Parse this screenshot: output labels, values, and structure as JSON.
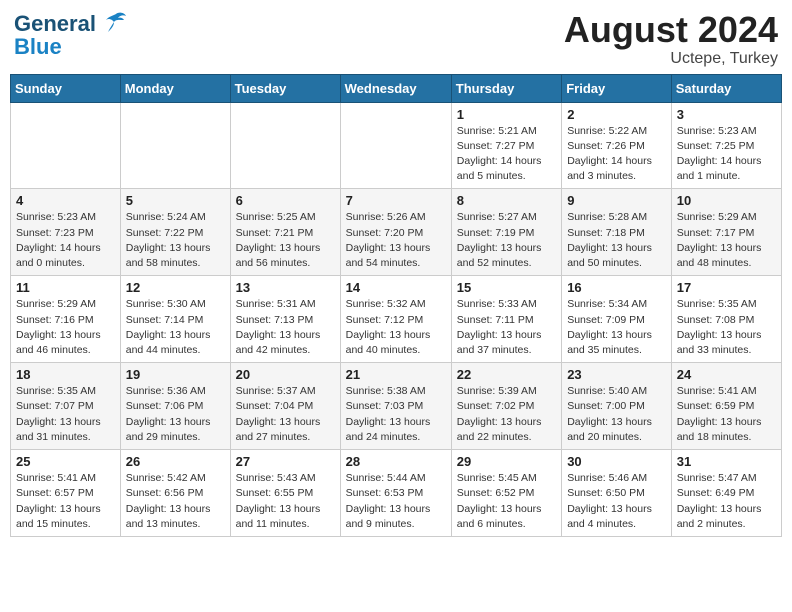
{
  "header": {
    "logo_line1": "General",
    "logo_line2": "Blue",
    "month_year": "August 2024",
    "location": "Uctepe, Turkey"
  },
  "weekdays": [
    "Sunday",
    "Monday",
    "Tuesday",
    "Wednesday",
    "Thursday",
    "Friday",
    "Saturday"
  ],
  "weeks": [
    [
      {
        "day": "",
        "info": ""
      },
      {
        "day": "",
        "info": ""
      },
      {
        "day": "",
        "info": ""
      },
      {
        "day": "",
        "info": ""
      },
      {
        "day": "1",
        "info": "Sunrise: 5:21 AM\nSunset: 7:27 PM\nDaylight: 14 hours\nand 5 minutes."
      },
      {
        "day": "2",
        "info": "Sunrise: 5:22 AM\nSunset: 7:26 PM\nDaylight: 14 hours\nand 3 minutes."
      },
      {
        "day": "3",
        "info": "Sunrise: 5:23 AM\nSunset: 7:25 PM\nDaylight: 14 hours\nand 1 minute."
      }
    ],
    [
      {
        "day": "4",
        "info": "Sunrise: 5:23 AM\nSunset: 7:23 PM\nDaylight: 14 hours\nand 0 minutes."
      },
      {
        "day": "5",
        "info": "Sunrise: 5:24 AM\nSunset: 7:22 PM\nDaylight: 13 hours\nand 58 minutes."
      },
      {
        "day": "6",
        "info": "Sunrise: 5:25 AM\nSunset: 7:21 PM\nDaylight: 13 hours\nand 56 minutes."
      },
      {
        "day": "7",
        "info": "Sunrise: 5:26 AM\nSunset: 7:20 PM\nDaylight: 13 hours\nand 54 minutes."
      },
      {
        "day": "8",
        "info": "Sunrise: 5:27 AM\nSunset: 7:19 PM\nDaylight: 13 hours\nand 52 minutes."
      },
      {
        "day": "9",
        "info": "Sunrise: 5:28 AM\nSunset: 7:18 PM\nDaylight: 13 hours\nand 50 minutes."
      },
      {
        "day": "10",
        "info": "Sunrise: 5:29 AM\nSunset: 7:17 PM\nDaylight: 13 hours\nand 48 minutes."
      }
    ],
    [
      {
        "day": "11",
        "info": "Sunrise: 5:29 AM\nSunset: 7:16 PM\nDaylight: 13 hours\nand 46 minutes."
      },
      {
        "day": "12",
        "info": "Sunrise: 5:30 AM\nSunset: 7:14 PM\nDaylight: 13 hours\nand 44 minutes."
      },
      {
        "day": "13",
        "info": "Sunrise: 5:31 AM\nSunset: 7:13 PM\nDaylight: 13 hours\nand 42 minutes."
      },
      {
        "day": "14",
        "info": "Sunrise: 5:32 AM\nSunset: 7:12 PM\nDaylight: 13 hours\nand 40 minutes."
      },
      {
        "day": "15",
        "info": "Sunrise: 5:33 AM\nSunset: 7:11 PM\nDaylight: 13 hours\nand 37 minutes."
      },
      {
        "day": "16",
        "info": "Sunrise: 5:34 AM\nSunset: 7:09 PM\nDaylight: 13 hours\nand 35 minutes."
      },
      {
        "day": "17",
        "info": "Sunrise: 5:35 AM\nSunset: 7:08 PM\nDaylight: 13 hours\nand 33 minutes."
      }
    ],
    [
      {
        "day": "18",
        "info": "Sunrise: 5:35 AM\nSunset: 7:07 PM\nDaylight: 13 hours\nand 31 minutes."
      },
      {
        "day": "19",
        "info": "Sunrise: 5:36 AM\nSunset: 7:06 PM\nDaylight: 13 hours\nand 29 minutes."
      },
      {
        "day": "20",
        "info": "Sunrise: 5:37 AM\nSunset: 7:04 PM\nDaylight: 13 hours\nand 27 minutes."
      },
      {
        "day": "21",
        "info": "Sunrise: 5:38 AM\nSunset: 7:03 PM\nDaylight: 13 hours\nand 24 minutes."
      },
      {
        "day": "22",
        "info": "Sunrise: 5:39 AM\nSunset: 7:02 PM\nDaylight: 13 hours\nand 22 minutes."
      },
      {
        "day": "23",
        "info": "Sunrise: 5:40 AM\nSunset: 7:00 PM\nDaylight: 13 hours\nand 20 minutes."
      },
      {
        "day": "24",
        "info": "Sunrise: 5:41 AM\nSunset: 6:59 PM\nDaylight: 13 hours\nand 18 minutes."
      }
    ],
    [
      {
        "day": "25",
        "info": "Sunrise: 5:41 AM\nSunset: 6:57 PM\nDaylight: 13 hours\nand 15 minutes."
      },
      {
        "day": "26",
        "info": "Sunrise: 5:42 AM\nSunset: 6:56 PM\nDaylight: 13 hours\nand 13 minutes."
      },
      {
        "day": "27",
        "info": "Sunrise: 5:43 AM\nSunset: 6:55 PM\nDaylight: 13 hours\nand 11 minutes."
      },
      {
        "day": "28",
        "info": "Sunrise: 5:44 AM\nSunset: 6:53 PM\nDaylight: 13 hours\nand 9 minutes."
      },
      {
        "day": "29",
        "info": "Sunrise: 5:45 AM\nSunset: 6:52 PM\nDaylight: 13 hours\nand 6 minutes."
      },
      {
        "day": "30",
        "info": "Sunrise: 5:46 AM\nSunset: 6:50 PM\nDaylight: 13 hours\nand 4 minutes."
      },
      {
        "day": "31",
        "info": "Sunrise: 5:47 AM\nSunset: 6:49 PM\nDaylight: 13 hours\nand 2 minutes."
      }
    ]
  ]
}
